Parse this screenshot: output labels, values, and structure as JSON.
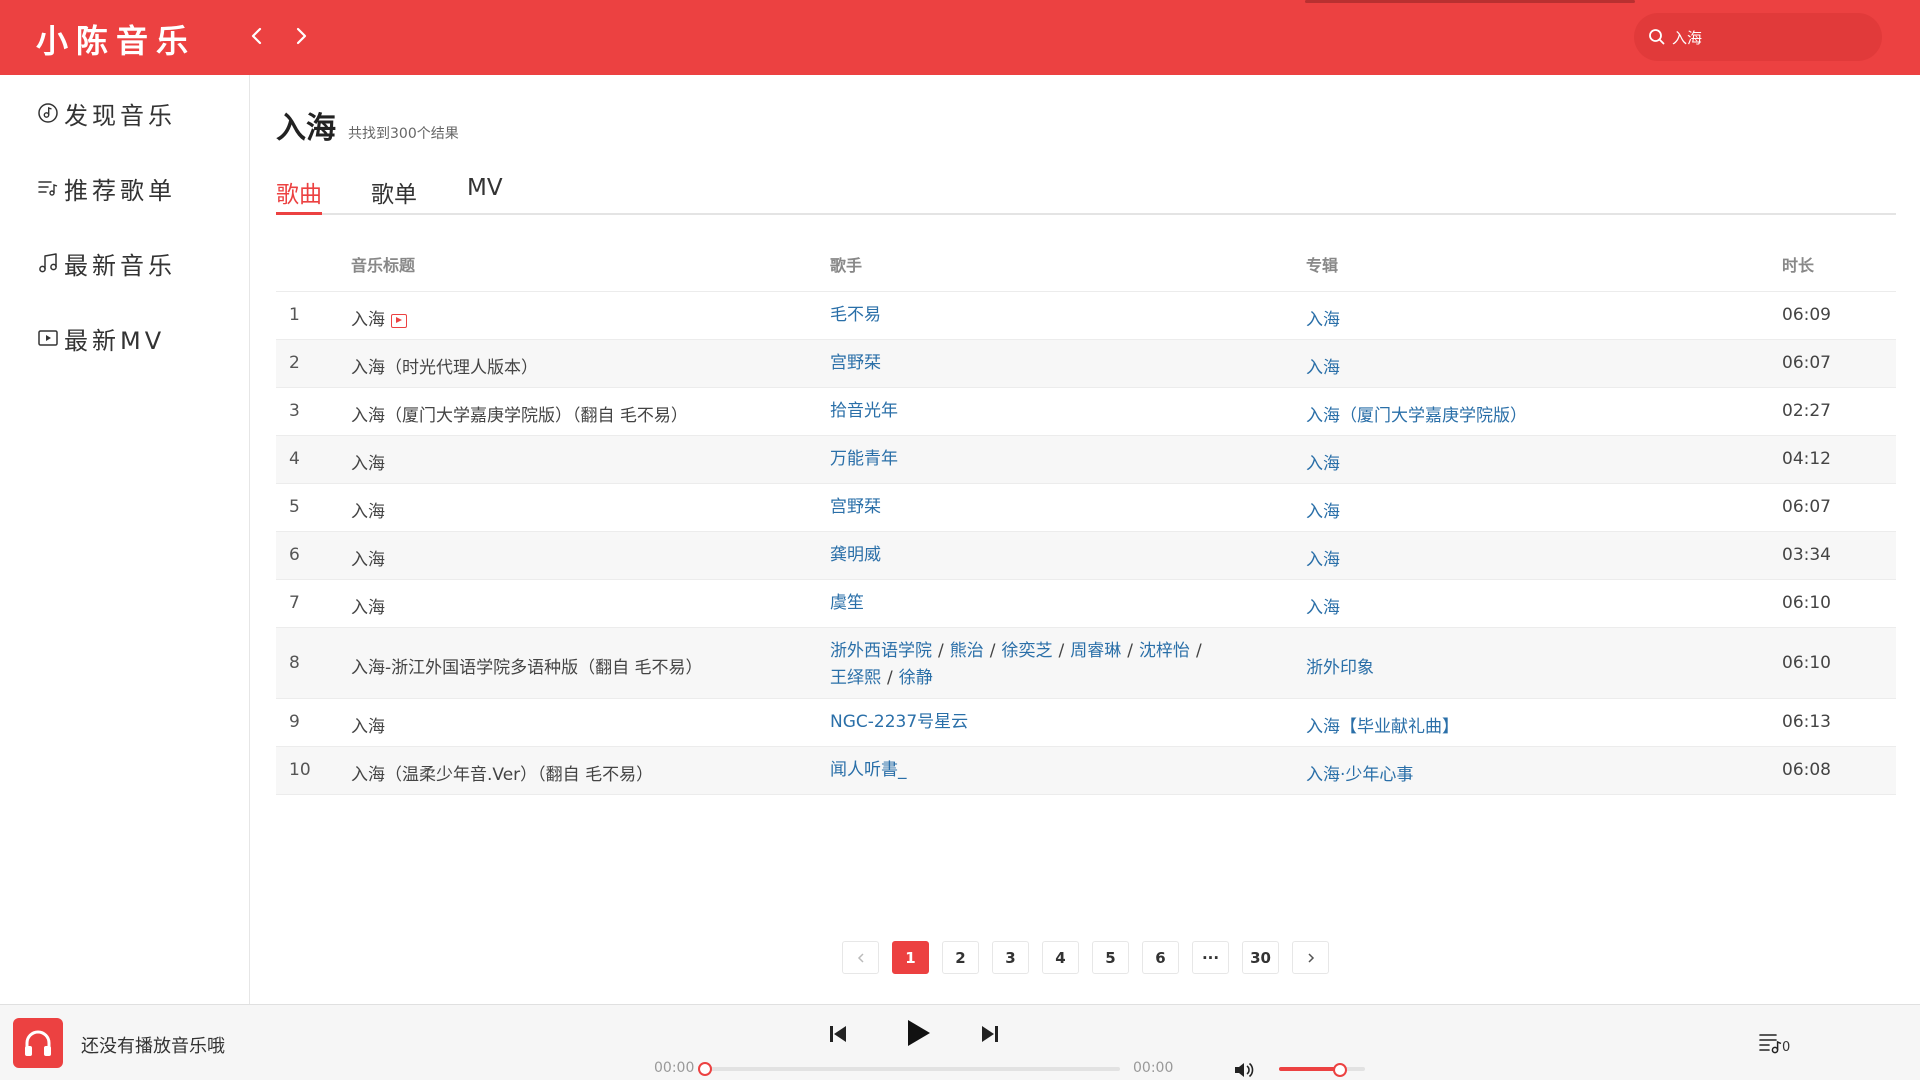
{
  "header": {
    "brand": "小陈音乐",
    "back_icon": "chevron-left-icon",
    "forward_icon": "chevron-right-icon",
    "search": {
      "value": "入海",
      "icon": "search-icon"
    },
    "bg_color": "#ec4141"
  },
  "sidebar": {
    "items": [
      {
        "label": "发现音乐",
        "icon": "music-disc-icon"
      },
      {
        "label": "推荐歌单",
        "icon": "playlist-icon"
      },
      {
        "label": "最新音乐",
        "icon": "music-note-icon"
      },
      {
        "label": "最新MV",
        "icon": "video-play-icon"
      }
    ]
  },
  "main": {
    "title": "入海",
    "result_count": "共找到300个结果",
    "tabs": [
      {
        "label": "歌曲",
        "active": true
      },
      {
        "label": "歌单",
        "active": false
      },
      {
        "label": "MV",
        "active": false
      }
    ],
    "columns": [
      "音乐标题",
      "歌手",
      "专辑",
      "时长"
    ],
    "songs": [
      {
        "index": "1",
        "title": "入海",
        "has_mv": true,
        "artists": [
          "毛不易"
        ],
        "album": "入海",
        "duration": "06:09"
      },
      {
        "index": "2",
        "title": "入海（时光代理人版本）",
        "has_mv": false,
        "artists": [
          "宫野栞"
        ],
        "album": "入海",
        "duration": "06:07"
      },
      {
        "index": "3",
        "title": "入海（厦门大学嘉庚学院版）（翻自 毛不易）",
        "has_mv": false,
        "artists": [
          "拾音光年"
        ],
        "album": "入海（厦门大学嘉庚学院版）",
        "duration": "02:27"
      },
      {
        "index": "4",
        "title": "入海",
        "has_mv": false,
        "artists": [
          "万能青年"
        ],
        "album": "入海",
        "duration": "04:12"
      },
      {
        "index": "5",
        "title": "入海",
        "has_mv": false,
        "artists": [
          "宫野栞"
        ],
        "album": "入海",
        "duration": "06:07"
      },
      {
        "index": "6",
        "title": "入海",
        "has_mv": false,
        "artists": [
          "龚明威"
        ],
        "album": "入海",
        "duration": "03:34"
      },
      {
        "index": "7",
        "title": "入海",
        "has_mv": false,
        "artists": [
          "虞笙"
        ],
        "album": "入海",
        "duration": "06:10"
      },
      {
        "index": "8",
        "title": "入海-浙江外国语学院多语种版（翻自 毛不易）",
        "has_mv": false,
        "artists": [
          "浙外西语学院",
          "熊治",
          "徐奕芝",
          "周睿琳",
          "沈梓怡",
          "王绎熙",
          "徐静"
        ],
        "album": "浙外印象",
        "duration": "06:10"
      },
      {
        "index": "9",
        "title": "入海",
        "has_mv": false,
        "artists": [
          "NGC-2237号星云"
        ],
        "album": "入海【毕业献礼曲】",
        "duration": "06:13"
      },
      {
        "index": "10",
        "title": "入海（温柔少年音.Ver）（翻自 毛不易）",
        "has_mv": false,
        "artists": [
          "闻人听書_"
        ],
        "album": "入海·少年心事",
        "duration": "06:08"
      }
    ],
    "pagination": {
      "prev_icon": "chevron-left-icon",
      "next_icon": "chevron-right-icon",
      "pages": [
        "1",
        "2",
        "3",
        "4",
        "5",
        "6",
        "···",
        "30"
      ],
      "current": "1"
    }
  },
  "player": {
    "cover_icon": "headphones-icon",
    "message": "还没有播放音乐哦",
    "prev_icon": "skip-previous-icon",
    "play_icon": "play-icon",
    "next_icon": "skip-next-icon",
    "current_time": "00:00",
    "total_time": "00:00",
    "progress": 0,
    "volume_icon": "volume-icon",
    "volume": 0.65,
    "playlist_icon": "playlist-queue-icon",
    "playlist_count": "0"
  }
}
